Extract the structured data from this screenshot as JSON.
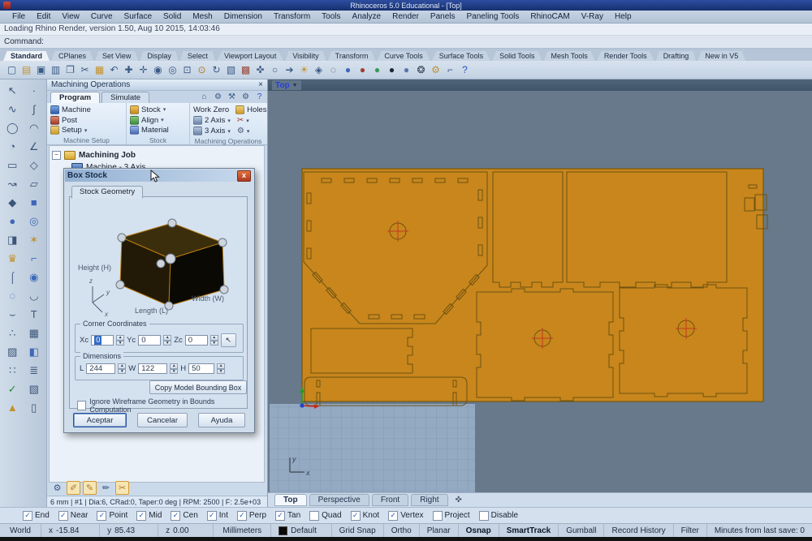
{
  "window": {
    "title": "Rhinoceros 5.0 Educational - [Top]"
  },
  "menu": {
    "items": [
      "File",
      "Edit",
      "View",
      "Curve",
      "Surface",
      "Solid",
      "Mesh",
      "Dimension",
      "Transform",
      "Tools",
      "Analyze",
      "Render",
      "Panels",
      "Paneling Tools",
      "RhinoCAM",
      "V-Ray",
      "Help"
    ]
  },
  "command": {
    "history": "Loading Rhino Render, version 1.50, Aug 10 2015, 14:03:46",
    "prompt": "Command:"
  },
  "toolbar": {
    "tabs": [
      {
        "label": "Standard",
        "active": true
      },
      {
        "label": "CPlanes",
        "active": false
      },
      {
        "label": "Set View",
        "active": false
      },
      {
        "label": "Display",
        "active": false
      },
      {
        "label": "Select",
        "active": false
      },
      {
        "label": "Viewport Layout",
        "active": false
      },
      {
        "label": "Visibility",
        "active": false
      },
      {
        "label": "Transform",
        "active": false
      },
      {
        "label": "Curve Tools",
        "active": false
      },
      {
        "label": "Surface Tools",
        "active": false
      },
      {
        "label": "Solid Tools",
        "active": false
      },
      {
        "label": "Mesh Tools",
        "active": false
      },
      {
        "label": "Render Tools",
        "active": false
      },
      {
        "label": "Drafting",
        "active": false
      },
      {
        "label": "New in V5",
        "active": false
      }
    ],
    "icons": [
      {
        "name": "new-document",
        "glyph": "▢",
        "color": "#3a5a86"
      },
      {
        "name": "open-file",
        "glyph": "▤",
        "color": "#c2912c"
      },
      {
        "name": "save",
        "glyph": "▣",
        "color": "#3a5a86"
      },
      {
        "name": "print",
        "glyph": "▥",
        "color": "#3a5a86"
      },
      {
        "name": "copy",
        "glyph": "❐",
        "color": "#3a5a86"
      },
      {
        "name": "cut",
        "glyph": "✂",
        "color": "#3a5a86"
      },
      {
        "name": "paste",
        "glyph": "▦",
        "color": "#c2912c"
      },
      {
        "name": "undo",
        "glyph": "↶",
        "color": "#3a5a86"
      },
      {
        "name": "pan",
        "glyph": "✚",
        "color": "#3a5a86"
      },
      {
        "name": "move",
        "glyph": "✛",
        "color": "#3a5a86"
      },
      {
        "name": "zoom-dynamic",
        "glyph": "◉",
        "color": "#3a5a86"
      },
      {
        "name": "zoom-window",
        "glyph": "◎",
        "color": "#3a5a86"
      },
      {
        "name": "zoom-extents",
        "glyph": "⊡",
        "color": "#3a5a86"
      },
      {
        "name": "zoom-selected",
        "glyph": "⊙",
        "color": "#b0782a"
      },
      {
        "name": "rotate-view",
        "glyph": "↻",
        "color": "#3a5a86"
      },
      {
        "name": "viewport-layout",
        "glyph": "▧",
        "color": "#3a5a86"
      },
      {
        "name": "set-view",
        "glyph": "▩",
        "color": "#9a4a3a"
      },
      {
        "name": "object-snap",
        "glyph": "✜",
        "color": "#3a5a86"
      },
      {
        "name": "circle-tool",
        "glyph": "○",
        "color": "#3a5a86"
      },
      {
        "name": "analyze-direction",
        "glyph": "➔",
        "color": "#3a5a86"
      },
      {
        "name": "lamp",
        "glyph": "☀",
        "color": "#c2912c"
      },
      {
        "name": "lock",
        "glyph": "◈",
        "color": "#3a5a86"
      },
      {
        "name": "wireframe-display",
        "glyph": "◌",
        "color": "#444c5a"
      },
      {
        "name": "shaded-display",
        "glyph": "●",
        "color": "#3e68b8"
      },
      {
        "name": "rendered-display",
        "glyph": "●",
        "color": "#a23c2e"
      },
      {
        "name": "ghosted-display",
        "glyph": "●",
        "color": "#3a9a54"
      },
      {
        "name": "xray-display",
        "glyph": "●",
        "color": "#20262e"
      },
      {
        "name": "raytraced-display",
        "glyph": "●",
        "color": "#5577aa"
      },
      {
        "name": "render",
        "glyph": "❂",
        "color": "#334055"
      },
      {
        "name": "render-settings",
        "glyph": "⚙",
        "color": "#c2912c"
      },
      {
        "name": "link-cplane",
        "glyph": "⌐",
        "color": "#3a5a86"
      },
      {
        "name": "help",
        "glyph": "?",
        "color": "#2a52c0"
      }
    ]
  },
  "side_toolbar": {
    "icons": [
      {
        "name": "select-pointer",
        "glyph": "↖"
      },
      {
        "name": "single-point",
        "glyph": "∙"
      },
      {
        "name": "curve-freeform",
        "glyph": "∿"
      },
      {
        "name": "curve-control-points",
        "glyph": "∫"
      },
      {
        "name": "circle-center-radius",
        "glyph": "◯"
      },
      {
        "name": "arc-center",
        "glyph": "◠"
      },
      {
        "name": "ellipse",
        "glyph": "◔"
      },
      {
        "name": "polyline",
        "glyph": "∠"
      },
      {
        "name": "rectangle",
        "glyph": "▭"
      },
      {
        "name": "polygon",
        "glyph": "◇"
      },
      {
        "name": "curve-interpolate",
        "glyph": "↝"
      },
      {
        "name": "surface-plane",
        "glyph": "▱"
      },
      {
        "name": "surface-loft",
        "glyph": "◆"
      },
      {
        "name": "solid-box",
        "glyph": "■",
        "color": "#3e68b8"
      },
      {
        "name": "solid-sphere",
        "glyph": "●",
        "color": "#3e68b8"
      },
      {
        "name": "torus",
        "glyph": "◎",
        "color": "#3e68b8"
      },
      {
        "name": "extrude-surface",
        "glyph": "◨"
      },
      {
        "name": "deform-tools",
        "glyph": "✶",
        "color": "#c2912c"
      },
      {
        "name": "crown-tool",
        "glyph": "♛",
        "color": "#c2912c"
      },
      {
        "name": "fillet-edge",
        "glyph": "⌐",
        "color": "#3e68b8"
      },
      {
        "name": "pipe-tool",
        "glyph": "⌠"
      },
      {
        "name": "boolean-union",
        "glyph": "◉",
        "color": "#3e68b8"
      },
      {
        "name": "boolean-difference",
        "glyph": "◌",
        "color": "#3e68b8"
      },
      {
        "name": "blend-curve",
        "glyph": "◡"
      },
      {
        "name": "adjust-blend",
        "glyph": "⌣"
      },
      {
        "name": "text-object",
        "glyph": "T"
      },
      {
        "name": "control-points-on",
        "glyph": "∴"
      },
      {
        "name": "block-tools",
        "glyph": "▦"
      },
      {
        "name": "hatch",
        "glyph": "▨"
      },
      {
        "name": "solid-tools",
        "glyph": "◧",
        "color": "#3e68b8"
      },
      {
        "name": "dots-grid",
        "glyph": "∷"
      },
      {
        "name": "array-tools",
        "glyph": "≣"
      },
      {
        "name": "visibility-check",
        "glyph": "✓",
        "color": "#2a8a3a"
      },
      {
        "name": "cplane-tool",
        "glyph": "▧"
      },
      {
        "name": "cone-tool",
        "glyph": "▲",
        "color": "#c2912c"
      },
      {
        "name": "cylinder-tool",
        "glyph": "▯"
      }
    ]
  },
  "cam": {
    "title": "Machining Operations",
    "tab_program": "Program",
    "tab_simulate": "Simulate",
    "header_icons": [
      {
        "name": "home",
        "glyph": "⌂",
        "color": "#3a5a86"
      },
      {
        "name": "machining-prefs",
        "glyph": "⚙",
        "color": "#3a5a86"
      },
      {
        "name": "post-tools",
        "glyph": "⚒",
        "color": "#3a5a86"
      },
      {
        "name": "settings",
        "glyph": "⚙",
        "color": "#3a5a86"
      },
      {
        "name": "help",
        "glyph": "?",
        "color": "#2a52c0"
      }
    ],
    "buttons": {
      "machine": "Machine",
      "post": "Post",
      "setup": "Setup",
      "stock": "Stock",
      "align": "Align",
      "material": "Material",
      "work_zero": "Work Zero",
      "two_axis": "2 Axis",
      "three_axis": "3 Axis",
      "holes": "Holes"
    },
    "groups": [
      "Machine Setup",
      "Stock",
      "Machining Operations"
    ],
    "tree": {
      "root": "Machining Job",
      "machine": "Machine - 3 Axis"
    },
    "footer_icons": [
      {
        "name": "stock-visibility",
        "glyph": "⚙",
        "color": "#3a5a86",
        "pressed": false
      },
      {
        "name": "tool-visibility",
        "glyph": "✐",
        "color": "#b0782a",
        "pressed": true
      },
      {
        "name": "toolpath-visibility",
        "glyph": "✎",
        "color": "#b0782a",
        "pressed": true
      },
      {
        "name": "material-texture",
        "glyph": "✏",
        "color": "#3a5a86",
        "pressed": false
      },
      {
        "name": "simulation-tools",
        "glyph": "✂",
        "color": "#b0782a",
        "pressed": true
      }
    ],
    "tool_info": "6 mm | #1 | Dia:6, CRad:0, Taper:0 deg | RPM: 2500 | F: 2.5e+03"
  },
  "dialog": {
    "title": "Box Stock",
    "tab": "Stock Geometry",
    "box_labels": {
      "height": "Height (H)",
      "width": "Width (W)",
      "length": "Length (L)",
      "ax_x": "x",
      "ax_y": "y",
      "ax_z": "z"
    },
    "corner": {
      "legend": "Corner Coordinates",
      "x_label": "Xc",
      "x_value": "0",
      "y_label": "Yc",
      "y_value": "0",
      "z_label": "Zc",
      "z_value": "0"
    },
    "dims": {
      "legend": "Dimensions",
      "l_label": "L",
      "l_value": "244",
      "w_label": "W",
      "w_value": "122",
      "h_label": "H",
      "h_value": "50"
    },
    "copy_button": "Copy Model Bounding Box",
    "checkbox_label": "Ignore Wireframe Geometry in Bounds Computation",
    "checkbox_checked": false,
    "ok": "Aceptar",
    "cancel": "Cancelar",
    "help": "Ayuda"
  },
  "viewport": {
    "label": "Top",
    "axis_x": "x",
    "axis_y": "y",
    "tabs": [
      {
        "label": "Top",
        "active": true
      },
      {
        "label": "Perspective",
        "active": false
      },
      {
        "label": "Front",
        "active": false
      },
      {
        "label": "Right",
        "active": false
      }
    ]
  },
  "osnap": [
    {
      "label": "End",
      "checked": true
    },
    {
      "label": "Near",
      "checked": true
    },
    {
      "label": "Point",
      "checked": true
    },
    {
      "label": "Mid",
      "checked": true
    },
    {
      "label": "Cen",
      "checked": true
    },
    {
      "label": "Int",
      "checked": true
    },
    {
      "label": "Perp",
      "checked": true
    },
    {
      "label": "Tan",
      "checked": true
    },
    {
      "label": "Quad",
      "checked": false
    },
    {
      "label": "Knot",
      "checked": true
    },
    {
      "label": "Vertex",
      "checked": true
    },
    {
      "label": "Project",
      "checked": false
    },
    {
      "label": "Disable",
      "checked": false
    }
  ],
  "status": {
    "world": "World",
    "coords": [
      {
        "label": "x",
        "value": "-15.84"
      },
      {
        "label": "y",
        "value": "85.43"
      },
      {
        "label": "z",
        "value": "0.00"
      }
    ],
    "units": "Millimeters",
    "layer": "Default",
    "toggles": [
      {
        "label": "Grid Snap",
        "active": false
      },
      {
        "label": "Ortho",
        "active": false
      },
      {
        "label": "Planar",
        "active": false
      },
      {
        "label": "Osnap",
        "active": true
      },
      {
        "label": "SmartTrack",
        "active": true
      },
      {
        "label": "Gumball",
        "active": false
      },
      {
        "label": "Record History",
        "active": false
      },
      {
        "label": "Filter",
        "active": false
      }
    ],
    "save_note": "Minutes from last save: 0"
  },
  "colors": {
    "sheet_orange": "#c8861c",
    "sheet_outline": "#6e5210",
    "viewport_bg": "#67798b",
    "selection_blue": "#316ac5",
    "crosshair_red": "#c3391f"
  }
}
